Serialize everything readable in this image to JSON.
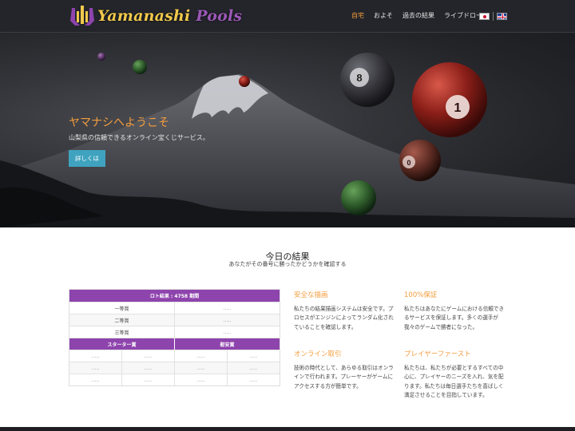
{
  "brand": {
    "name_part1": "Yamanashi",
    "name_part2": "Pools"
  },
  "nav": {
    "items": [
      {
        "label": "自宅",
        "active": true
      },
      {
        "label": "およそ",
        "active": false
      },
      {
        "label": "過去の結果",
        "active": false
      },
      {
        "label": "ライブドロー",
        "active": false
      }
    ],
    "languages": [
      "jp-flag-icon",
      "uk-flag-icon"
    ]
  },
  "hero": {
    "title": "ヤマナシへようこそ",
    "subtitle": "山梨県の信頼できるオンライン宝くじサービス。",
    "button_label": "詳しくは",
    "ball_numbers": [
      "8",
      "1",
      "0"
    ]
  },
  "results": {
    "title": "今日の結果",
    "subtitle": "あなたがその番号に勝ったかどうかを確認する",
    "table": {
      "header": "ロト結果 : 4758 期間",
      "prizes": [
        {
          "label": "一等賞",
          "value": "....."
        },
        {
          "label": "二等賞",
          "value": "....."
        },
        {
          "label": "三等賞",
          "value": "....."
        }
      ],
      "starter_header": "スターター賞",
      "consolation_header": "慰安賞",
      "starter_rows": [
        [
          ".....",
          "....."
        ],
        [
          ".....",
          "....."
        ],
        [
          ".....",
          "....."
        ]
      ],
      "consolation_rows": [
        [
          ".....",
          "....."
        ],
        [
          ".....",
          "....."
        ],
        [
          ".....",
          "....."
        ]
      ]
    }
  },
  "features": [
    {
      "title": "安全な描画",
      "text": "私たちの結果描画システムは安全です。プロセスがエンジンによってランダム化されていることを確認します。"
    },
    {
      "title": "100%保証",
      "text": "私たちはあなたにゲームにおける信頼できるサービスを保証します。多くの選手が我々のゲームで勝者になった。"
    },
    {
      "title": "オンライン取引",
      "text": "技術の時代として、あらゆる取引はオンラインで行われます。プレーヤーがゲームにアクセスする方が簡単です。"
    },
    {
      "title": "プレイヤーファースト",
      "text": "私たちは、私たちが必要とするすべての中心に、プレイヤーのニーズを入れ、気を配ります。私たちは毎日選手たちを喜ばしく満足させることを目指しています。"
    }
  ],
  "colors": {
    "accent_orange": "#f39c3d",
    "table_purple": "#8e44ad",
    "button_blue": "#3fa3bf",
    "nav_bg": "#23252b"
  }
}
